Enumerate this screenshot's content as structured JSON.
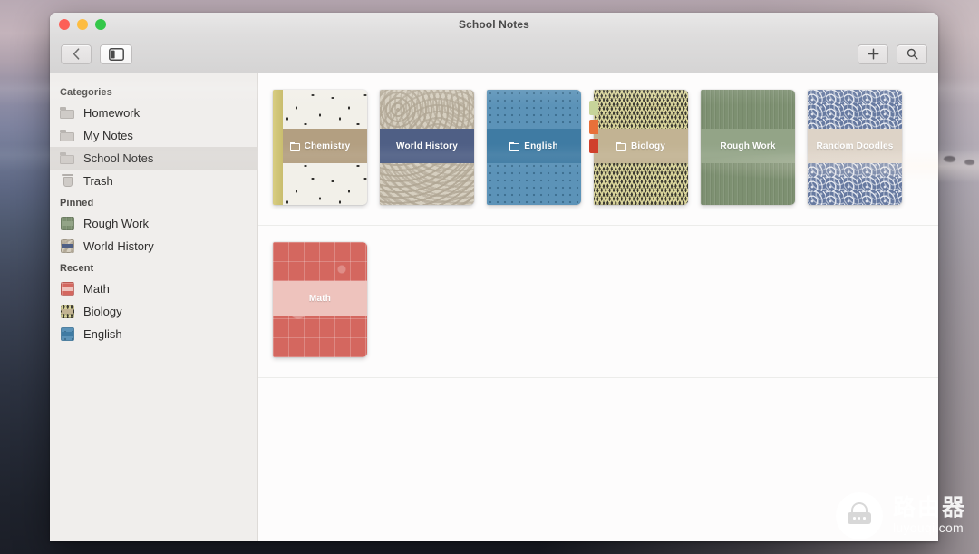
{
  "window": {
    "title": "School Notes",
    "traffic_lights": [
      "close",
      "minimize",
      "maximize"
    ]
  },
  "toolbar": {
    "back_icon": "chevron-left-icon",
    "sidebar_toggle_icon": "sidebar-toggle-icon",
    "add_icon": "plus-icon",
    "search_icon": "search-icon"
  },
  "sidebar": {
    "sections": [
      {
        "header": "Categories",
        "items": [
          {
            "label": "Homework",
            "icon": "folder-icon",
            "selected": false
          },
          {
            "label": "My Notes",
            "icon": "folder-icon",
            "selected": false
          },
          {
            "label": "School Notes",
            "icon": "folder-icon",
            "selected": true
          },
          {
            "label": "Trash",
            "icon": "trash-icon",
            "selected": false
          }
        ]
      },
      {
        "header": "Pinned",
        "items": [
          {
            "label": "Rough Work",
            "icon": "notebook-swatch",
            "color": "#7d9071",
            "band": "#93a487",
            "selected": false
          },
          {
            "label": "World History",
            "icon": "notebook-swatch",
            "color": "#cfc6b4",
            "band": "#4f5f85",
            "selected": false
          }
        ]
      },
      {
        "header": "Recent",
        "items": [
          {
            "label": "Math",
            "icon": "notebook-swatch",
            "color": "#d4675f",
            "band": "#eec3bd",
            "selected": false
          },
          {
            "label": "Biology",
            "icon": "notebook-swatch",
            "color": "#3d3b33",
            "band": "#c2b393",
            "selected": false
          },
          {
            "label": "English",
            "icon": "notebook-swatch",
            "color": "#5c93b8",
            "band": "#3f7ba3",
            "selected": false
          }
        ]
      }
    ]
  },
  "content": {
    "rows": [
      {
        "notebooks": [
          {
            "title": "Chemistry",
            "pattern": "pat-speckle",
            "band_color": "#b39f81",
            "has_folder_icon": true,
            "binding_color": "#cdc27a",
            "tabs": []
          },
          {
            "title": "World History",
            "pattern": "pat-swirl",
            "band_color": "#4f5f85",
            "has_folder_icon": false,
            "binding_color": "",
            "tabs": []
          },
          {
            "title": "English",
            "pattern": "pat-dots",
            "band_color": "#3f7ba3",
            "has_folder_icon": true,
            "binding_color": "",
            "tabs": []
          },
          {
            "title": "Biology",
            "pattern": "pat-zig",
            "band_color": "#c2b393",
            "has_folder_icon": true,
            "binding_color": "",
            "tabs": [
              "#c7d49a",
              "#e8703a",
              "#d0402c"
            ]
          },
          {
            "title": "Rough Work",
            "pattern": "pat-grain",
            "band_color": "#93a487",
            "has_folder_icon": false,
            "binding_color": "",
            "tabs": []
          },
          {
            "title": "Random Doodles",
            "pattern": "pat-scallop",
            "band_color": "#ddd3c7",
            "has_folder_icon": false,
            "binding_color": "",
            "tabs": []
          }
        ]
      },
      {
        "notebooks": [
          {
            "title": "Math",
            "pattern": "pat-doodle",
            "band_color": "#eec3bd",
            "has_folder_icon": false,
            "binding_color": "",
            "tabs": []
          }
        ]
      }
    ]
  },
  "watermark": {
    "chinese": "路由器",
    "url": "luyouqi.com",
    "icon": "router-icon"
  }
}
